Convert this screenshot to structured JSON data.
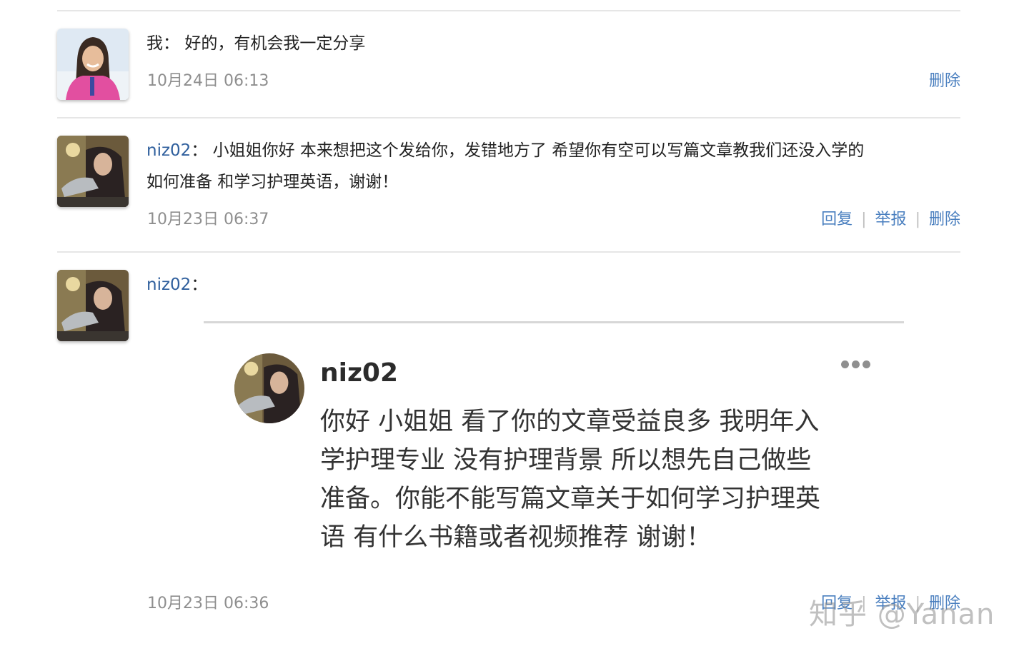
{
  "comments": [
    {
      "author": "我",
      "separator": "：",
      "text": "好的，有机会我一定分享",
      "time": "10月24日 06:13",
      "actions": [
        "删除"
      ]
    },
    {
      "author": "niz02",
      "separator": "：",
      "text_line1": "小姐姐你好 本来想把这个发给你，发错地方了 希望你有空可以写篇文章教我们还没入学的",
      "text_line2": "如何准备 和学习护理英语，谢谢！",
      "time": "10月23日 06:37",
      "actions": [
        "回复",
        "举报",
        "删除"
      ]
    },
    {
      "author": "niz02",
      "separator": "：",
      "time": "10月23日 06:36",
      "actions": [
        "回复",
        "举报",
        "删除"
      ],
      "embedded_post": {
        "author": "niz02",
        "more_icon": "more-dots-icon",
        "lines": [
          "你好 小姐姐 看了你的文章受益良多 我明年入",
          "学护理专业 没有护理背景 所以想先自己做些",
          "准备。你能不能写篇文章关于如何学习护理英",
          "语 有什么书籍或者视频推荐 谢谢！"
        ]
      }
    }
  ],
  "watermark": "知乎 @Yanan",
  "colors": {
    "username": "#2f5f9d",
    "action_link": "#4a7fbf",
    "timestamp": "#8e8e8e",
    "divider": "#e6e6e6"
  }
}
